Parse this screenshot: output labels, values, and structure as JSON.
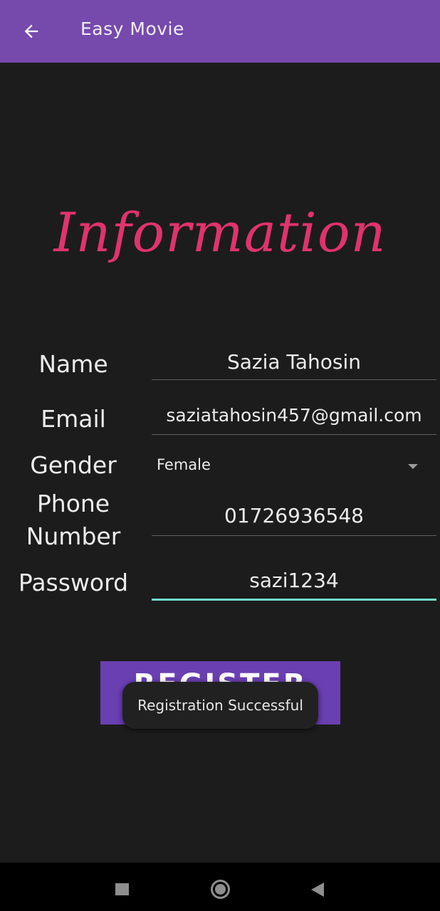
{
  "app_bar": {
    "title": "Easy Movie",
    "back_icon": "arrow-left-icon",
    "color": "#764aad"
  },
  "heading": {
    "text": "Information",
    "color": "#e0336c"
  },
  "form": {
    "name": {
      "label": "Name",
      "value": "Sazia Tahosin"
    },
    "email": {
      "label": "Email",
      "value": "saziatahosin457@gmail.com"
    },
    "gender": {
      "label": "Gender",
      "value": "Female",
      "icon": "dropdown-arrow-icon"
    },
    "phone": {
      "label_line1": "Phone",
      "label_line2": "Number",
      "value": "01726936548"
    },
    "password": {
      "label": "Password",
      "value": "sazi1234"
    },
    "focus_color": "#6fdccc"
  },
  "register_button": {
    "label": "REGISTER",
    "color": "#6a3fb1"
  },
  "toast": {
    "text": "Registration Successful"
  },
  "nav_bar": {
    "recents_icon": "square-icon",
    "home_icon": "circle-icon",
    "back_icon": "triangle-back-icon"
  }
}
